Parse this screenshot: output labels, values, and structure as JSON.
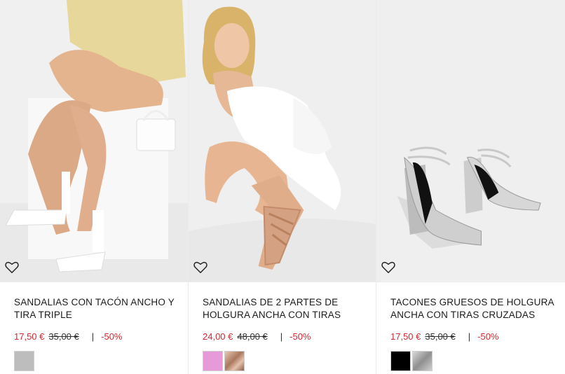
{
  "products": [
    {
      "title": "SANDALIAS CON TACÓN ANCHO Y TIRA TRIPLE",
      "price": "17,50 €",
      "old_price": "35,00 €",
      "separator": "|",
      "discount": "-50%",
      "swatches": [
        {
          "name": "silver-swatch",
          "color": "#bdbdbd"
        }
      ]
    },
    {
      "title": "SANDALIAS DE 2 PARTES DE HOLGURA ANCHA CON TIRAS",
      "price": "24,00 €",
      "old_price": "48,00 €",
      "separator": "|",
      "discount": "-50%",
      "swatches": [
        {
          "name": "pink-swatch",
          "color": "#e79ad8"
        },
        {
          "name": "rose-gold-swatch",
          "color": "#c99e86"
        }
      ]
    },
    {
      "title": "TACONES GRUESOS DE HOLGURA ANCHA CON TIRAS CRUZADAS",
      "price": "17,50 €",
      "old_price": "35,00 €",
      "separator": "|",
      "discount": "-50%",
      "swatches": [
        {
          "name": "black-swatch",
          "color": "#000000"
        },
        {
          "name": "silver-swatch",
          "color": "#a9a9a9"
        }
      ]
    }
  ],
  "colors": {
    "sale_red": "#d0292f",
    "image_bg": "#efefef",
    "border": "#ececec"
  },
  "icons": {
    "favorite": "heart-outline-icon"
  }
}
